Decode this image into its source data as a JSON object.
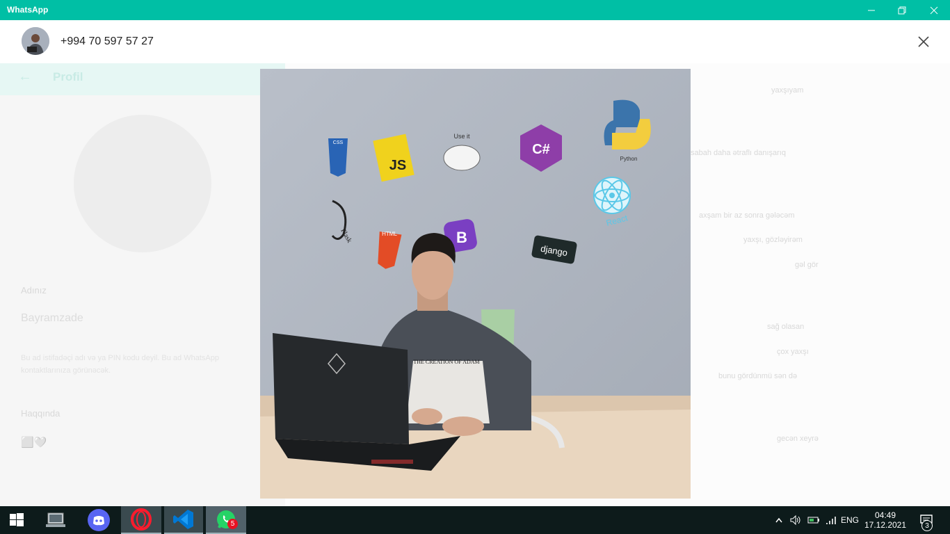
{
  "window": {
    "title": "WhatsApp",
    "accent_color": "#00bfa5"
  },
  "background_app": {
    "profile_title": "Profil",
    "name_label": "Adınız",
    "name_value": "Bayramzade",
    "name_description": "Bu ad istifadəçi adı və ya PIN kodu deyil. Bu ad WhatsApp kontaktlarınıza görünəcək.",
    "about_label": "Haqqında",
    "about_value": "⬜🤍",
    "chat_snippets": [
      "yaxşıyam",
      "sabah daha ətraflı danışarıq",
      "axşam bir az sonra gələcəm",
      "yaxşı, gözləyirəm",
      "gəl gör",
      "sağ olasan",
      "çox yaxşı",
      "bunu gördünmü sən də",
      "gecən xeyrə"
    ]
  },
  "viewer": {
    "contact_phone": "+994 70 597 57 27",
    "close_icon": "close-icon",
    "photo_stickers": [
      "CSS",
      "JS",
      "Use it",
      "C#",
      "Python",
      "Flask",
      "HTML",
      "B",
      "django",
      "React"
    ],
    "shirt_text": "THE CREATION OF ADAM"
  },
  "taskbar": {
    "apps": [
      {
        "name": "start",
        "icon": "windows-start-icon"
      },
      {
        "name": "file-explorer",
        "icon": "laptop-icon"
      },
      {
        "name": "discord",
        "icon": "discord-icon"
      },
      {
        "name": "opera",
        "icon": "opera-icon"
      },
      {
        "name": "vscode",
        "icon": "vscode-icon"
      },
      {
        "name": "whatsapp",
        "icon": "whatsapp-icon",
        "badge": "5"
      }
    ],
    "language": "ENG",
    "time": "04:49",
    "date": "17.12.2021",
    "notification_count": "3"
  }
}
